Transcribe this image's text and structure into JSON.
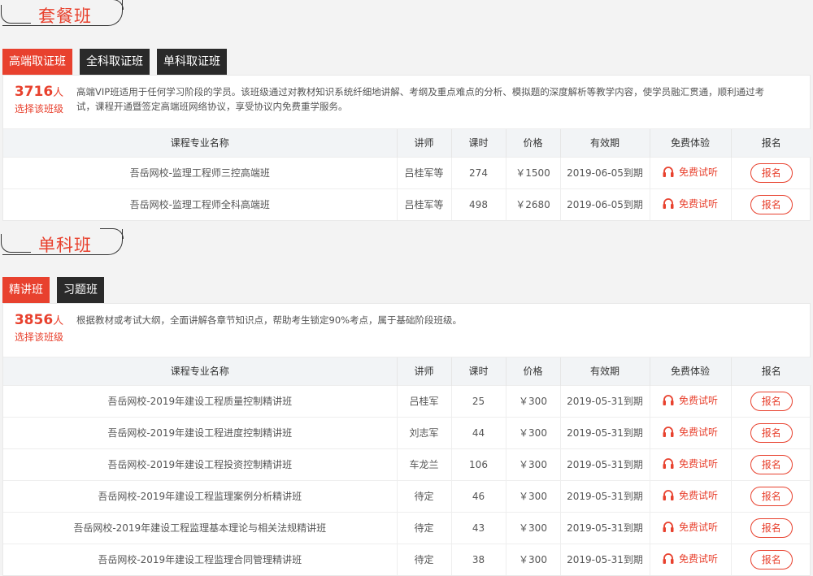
{
  "section1": {
    "title": "套餐班",
    "tabs": [
      {
        "label": "高端取证班",
        "active": true
      },
      {
        "label": "全科取证班",
        "active": false
      },
      {
        "label": "单科取证班",
        "active": false
      }
    ],
    "count": "3716",
    "count_unit": "人",
    "count_label": "选择该班级",
    "description": "高端VIP班适用于任何学习阶段的学员。该班级通过对教材知识系统纤细地讲解、考纲及重点难点的分析、模拟题的深度解析等教学内容，使学员融汇贯通，顺利通过考试，课程开通暨签定高端班网络协议，享受协议内免费重学服务。",
    "headers": [
      "课程专业名称",
      "讲师",
      "课时",
      "价格",
      "有效期",
      "免费体验",
      "报名"
    ],
    "rows": [
      {
        "name": "吾岳网校-监理工程师三控高端班",
        "teacher": "吕桂军等",
        "hours": "274",
        "price": "￥1500",
        "valid": "2019-06-05到期",
        "trial": "免费试听",
        "enroll": "报名"
      },
      {
        "name": "吾岳网校-监理工程师全科高端班",
        "teacher": "吕桂军等",
        "hours": "498",
        "price": "￥2680",
        "valid": "2019-06-05到期",
        "trial": "免费试听",
        "enroll": "报名"
      }
    ]
  },
  "section2": {
    "title": "单科班",
    "tabs": [
      {
        "label": "精讲班",
        "active": true
      },
      {
        "label": "习题班",
        "active": false
      }
    ],
    "count": "3856",
    "count_unit": "人",
    "count_label": "选择该班级",
    "description": "根据教材或考试大纲，全面讲解各章节知识点，帮助考生锁定90%考点，属于基础阶段班级。",
    "headers": [
      "课程专业名称",
      "讲师",
      "课时",
      "价格",
      "有效期",
      "免费体验",
      "报名"
    ],
    "rows": [
      {
        "name": "吾岳网校-2019年建设工程质量控制精讲班",
        "teacher": "吕桂军",
        "hours": "25",
        "price": "￥300",
        "valid": "2019-05-31到期",
        "trial": "免费试听",
        "enroll": "报名"
      },
      {
        "name": "吾岳网校-2019年建设工程进度控制精讲班",
        "teacher": "刘志军",
        "hours": "44",
        "price": "￥300",
        "valid": "2019-05-31到期",
        "trial": "免费试听",
        "enroll": "报名"
      },
      {
        "name": "吾岳网校-2019年建设工程投资控制精讲班",
        "teacher": "车龙兰",
        "hours": "106",
        "price": "￥300",
        "valid": "2019-05-31到期",
        "trial": "免费试听",
        "enroll": "报名"
      },
      {
        "name": "吾岳网校-2019年建设工程监理案例分析精讲班",
        "teacher": "待定",
        "hours": "46",
        "price": "￥300",
        "valid": "2019-05-31到期",
        "trial": "免费试听",
        "enroll": "报名"
      },
      {
        "name": "吾岳网校-2019年建设工程监理基本理论与相关法规精讲班",
        "teacher": "待定",
        "hours": "43",
        "price": "￥300",
        "valid": "2019-05-31到期",
        "trial": "免费试听",
        "enroll": "报名"
      },
      {
        "name": "吾岳网校-2019年建设工程监理合同管理精讲班",
        "teacher": "待定",
        "hours": "38",
        "price": "￥300",
        "valid": "2019-05-31到期",
        "trial": "免费试听",
        "enroll": "报名"
      }
    ]
  }
}
